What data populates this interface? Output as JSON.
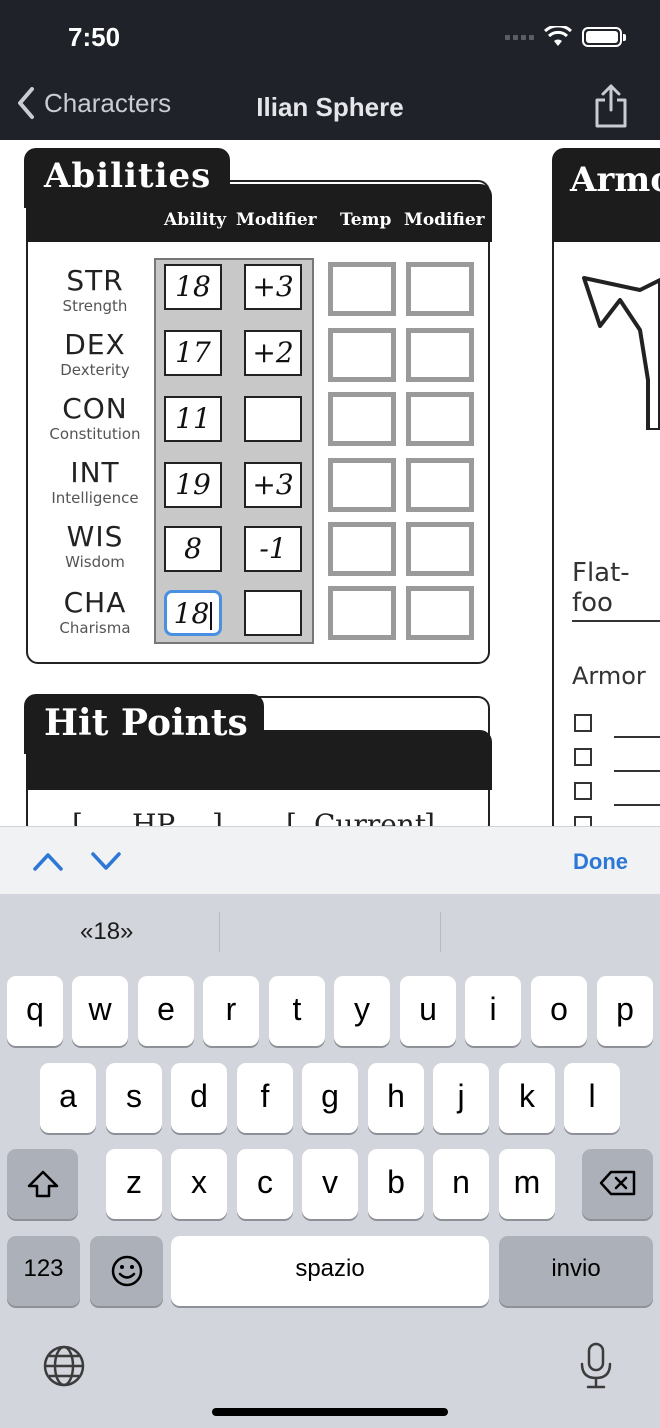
{
  "status_bar": {
    "time": "7:50"
  },
  "nav": {
    "back_label": "Characters",
    "title": "Ilian Sphere"
  },
  "abilities": {
    "title": "Abilities",
    "headers": {
      "ability": "Ability",
      "modifier": "Modifier",
      "temp": "Temp",
      "temp_modifier": "Modifier"
    },
    "rows": [
      {
        "abbr": "STR",
        "name": "Strength",
        "score": "18",
        "modifier": "+3"
      },
      {
        "abbr": "DEX",
        "name": "Dexterity",
        "score": "17",
        "modifier": "+2"
      },
      {
        "abbr": "CON",
        "name": "Constitution",
        "score": "11",
        "modifier": ""
      },
      {
        "abbr": "INT",
        "name": "Intelligence",
        "score": "19",
        "modifier": "+3"
      },
      {
        "abbr": "WIS",
        "name": "Wisdom",
        "score": "8",
        "modifier": "-1"
      },
      {
        "abbr": "CHA",
        "name": "Charisma",
        "score": "18",
        "modifier": ""
      }
    ]
  },
  "hit_points": {
    "title": "Hit Points",
    "hp_label": "HP",
    "current_label": "Current"
  },
  "armor": {
    "title": "Armo",
    "flat_footed": "Flat-foo",
    "armor_label": "Armor"
  },
  "accessory": {
    "done": "Done"
  },
  "keyboard": {
    "suggestions": [
      "«18»",
      "",
      ""
    ],
    "row1": [
      "q",
      "w",
      "e",
      "r",
      "t",
      "y",
      "u",
      "i",
      "o",
      "p"
    ],
    "row2": [
      "a",
      "s",
      "d",
      "f",
      "g",
      "h",
      "j",
      "k",
      "l"
    ],
    "row3": [
      "z",
      "x",
      "c",
      "v",
      "b",
      "n",
      "m"
    ],
    "numbers_key": "123",
    "space_key": "spazio",
    "return_key": "invio"
  }
}
